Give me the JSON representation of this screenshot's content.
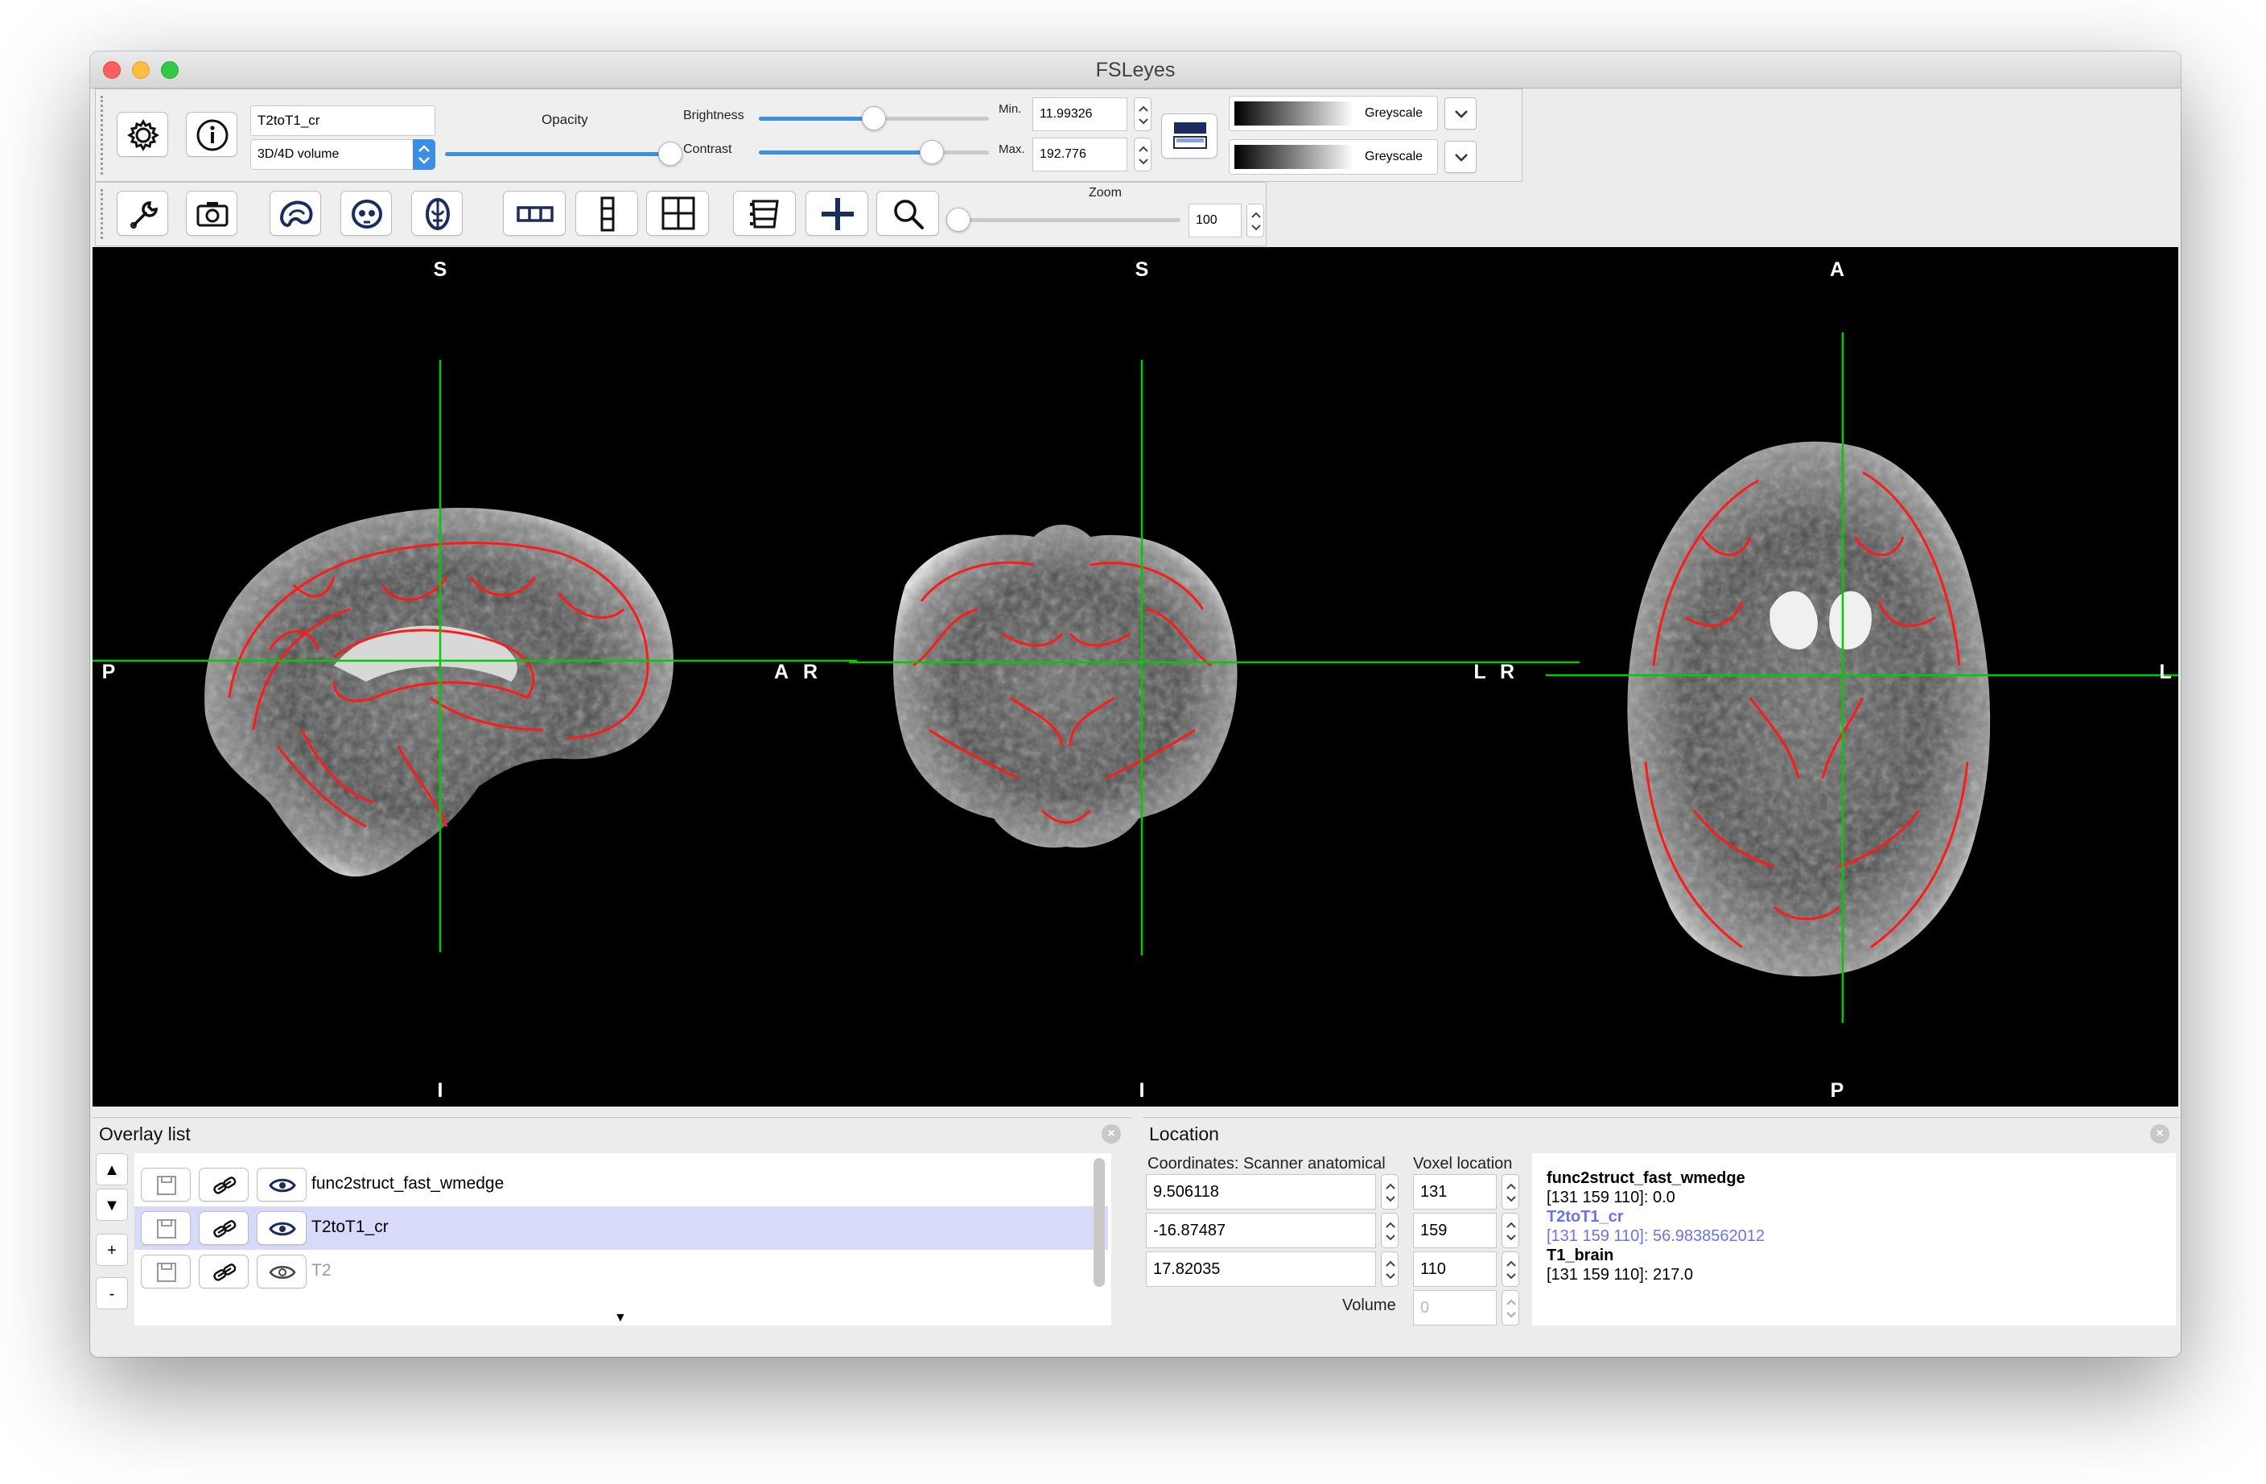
{
  "window": {
    "title": "FSLeyes"
  },
  "overlay_toolbar": {
    "overlay_name": "T2toT1_cr",
    "overlay_type": "3D/4D volume",
    "opacity_label": "Opacity",
    "opacity_value": 1.0,
    "brightness_label": "Brightness",
    "brightness_value": 0.5,
    "contrast_label": "Contrast",
    "contrast_value": 0.75,
    "min_label": "Min.",
    "min_value": "11.99326",
    "max_label": "Max.",
    "max_value": "192.776",
    "colormap_1": "Greyscale",
    "colormap_2": "Greyscale"
  },
  "ortho_toolbar": {
    "zoom_label": "Zoom",
    "zoom_value": "100",
    "zoom_slider_fraction": 0.0
  },
  "views": {
    "sagittal": {
      "top": "S",
      "bottom": "I",
      "left": "P",
      "right": "A"
    },
    "coronal": {
      "top": "S",
      "bottom": "I",
      "left": "R",
      "right": "L"
    },
    "axial": {
      "top": "A",
      "bottom": "P",
      "left": "R",
      "right": "L"
    }
  },
  "overlay_list": {
    "title": "Overlay list",
    "up_label": "▲",
    "down_label": "▼",
    "add_label": "+",
    "remove_label": "-",
    "items": [
      {
        "name": "func2struct_fast_wmedge",
        "visible": true,
        "selected": false
      },
      {
        "name": "T2toT1_cr",
        "visible": true,
        "selected": true
      },
      {
        "name": "T2",
        "visible": false,
        "selected": false
      }
    ]
  },
  "location": {
    "title": "Location",
    "coords_label": "Coordinates: Scanner anatomical",
    "voxel_label": "Voxel location",
    "coords": [
      "9.506118",
      "-16.87487",
      "17.82035"
    ],
    "voxels": [
      "131",
      "159",
      "110"
    ],
    "volume_label": "Volume",
    "volume_value": "0",
    "info": [
      {
        "name": "func2struct_fast_wmedge",
        "value": "[131 159 110]: 0.0",
        "highlight": false
      },
      {
        "name": "T2toT1_cr",
        "value": "[131 159 110]: 56.9838562012",
        "highlight": true
      },
      {
        "name": "T1_brain",
        "value": "[131 159 110]: 217.0",
        "highlight": false
      }
    ]
  },
  "colors": {
    "accent": "#3b8de6",
    "crosshair": "#00cc00",
    "edge": "#ff1a1a",
    "highlight_text": "#6b73e6",
    "selected_row": "#d8dafa"
  }
}
